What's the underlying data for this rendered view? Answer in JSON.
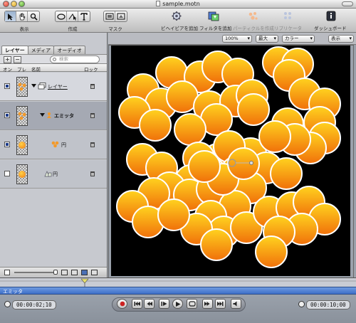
{
  "window": {
    "title": "sample.motn"
  },
  "toolbar": {
    "view_label": "表示",
    "create_label": "作成",
    "mask_label": "マスク",
    "add_behavior": "ビヘイビアを追加",
    "add_filter": "フィルタを追加",
    "make_particles": "パーティクルを作成",
    "replicate": "リプリケータ",
    "dashboard": "ダッシュボード"
  },
  "panel": {
    "tabs": [
      {
        "label": "レイヤー"
      },
      {
        "label": "メディア"
      },
      {
        "label": "オーディオ"
      }
    ],
    "search_placeholder": "検索",
    "columns": {
      "on": "オン",
      "preview": "プレ",
      "name": "名前",
      "lock": "ロック"
    },
    "layers": [
      {
        "name": "レイヤー",
        "checked": true
      },
      {
        "name": "エミッタ",
        "checked": true
      },
      {
        "name": "円",
        "checked": true
      },
      {
        "name": "円",
        "checked": false
      }
    ]
  },
  "canvas_bar": {
    "zoom": "100%",
    "size": "最大",
    "channel": "カラー",
    "view": "表示"
  },
  "timeline": {
    "track_label": "エミッタ",
    "current_time": "00:00:02;10",
    "duration": "00:00:10;00"
  },
  "colors": {
    "circle_light": "#ffd21f",
    "circle_dark": "#f0700a",
    "canvas_bg": "#000000",
    "track": "#4a7bd0"
  },
  "icons": [
    "select-icon",
    "hand-icon",
    "zoom-icon",
    "circle-icon",
    "bezier-icon",
    "text-icon",
    "mask-rect-icon",
    "mask-bezier-icon",
    "gear-icon",
    "filter-icon",
    "particles-icon",
    "replicate-icon",
    "dashboard-icon",
    "lock-icon",
    "clock-icon"
  ]
}
